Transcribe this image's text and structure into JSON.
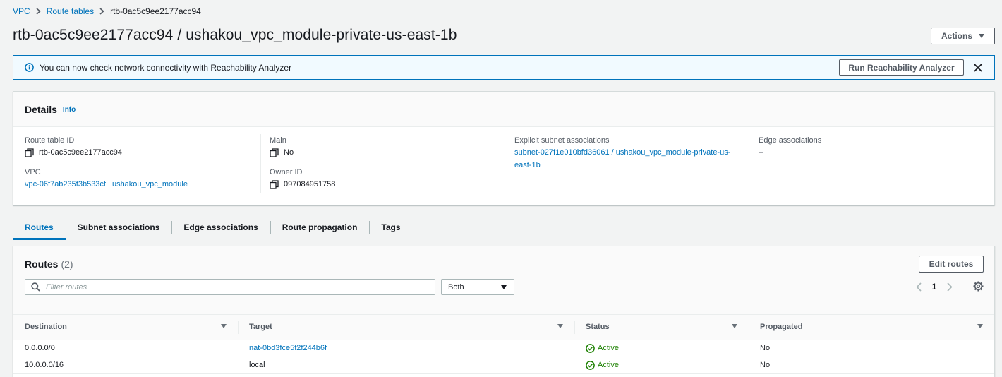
{
  "breadcrumb": {
    "items": [
      "VPC",
      "Route tables"
    ],
    "current": "rtb-0ac5c9ee2177acc94"
  },
  "page": {
    "title": "rtb-0ac5c9ee2177acc94 / ushakou_vpc_module-private-us-east-1b",
    "actions_label": "Actions"
  },
  "flash": {
    "message": "You can now check network connectivity with Reachability Analyzer",
    "button_label": "Run Reachability Analyzer"
  },
  "details": {
    "title": "Details",
    "info_label": "Info",
    "route_table_id": {
      "label": "Route table ID",
      "value": "rtb-0ac5c9ee2177acc94"
    },
    "vpc": {
      "label": "VPC",
      "value": "vpc-06f7ab235f3b533cf | ushakou_vpc_module"
    },
    "main": {
      "label": "Main",
      "value": "No"
    },
    "owner_id": {
      "label": "Owner ID",
      "value": "097084951758"
    },
    "explicit_subnet_associations": {
      "label": "Explicit subnet associations",
      "value": "subnet-027f1e010bfd36061 / ushakou_vpc_module-private-us-east-1b"
    },
    "edge_associations": {
      "label": "Edge associations",
      "value": "–"
    }
  },
  "tabs": [
    "Routes",
    "Subnet associations",
    "Edge associations",
    "Route propagation",
    "Tags"
  ],
  "routes": {
    "title": "Routes",
    "count": "(2)",
    "edit_label": "Edit routes",
    "filter_placeholder": "Filter routes",
    "filter_select": "Both",
    "page_number": "1",
    "columns": [
      "Destination",
      "Target",
      "Status",
      "Propagated"
    ],
    "rows": [
      {
        "destination": "0.0.0.0/0",
        "target": "nat-0bd3fce5f2f244b6f",
        "status": "Active",
        "propagated": "No"
      },
      {
        "destination": "10.0.0.0/16",
        "target": "local",
        "status": "Active",
        "propagated": "No"
      }
    ]
  },
  "colors": {
    "link": "#0073bb",
    "success": "#1d8102",
    "border": "#d5dbdb",
    "flash_bg": "#f1faff"
  }
}
